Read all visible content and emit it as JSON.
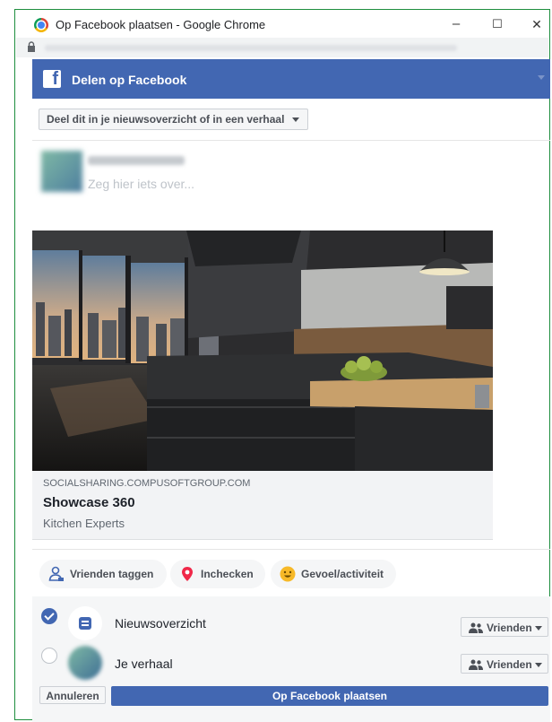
{
  "window": {
    "title": "Op Facebook plaatsen - Google Chrome",
    "minimize_glyph": "–",
    "maximize_glyph": "☐",
    "close_glyph": "✕"
  },
  "dialog": {
    "header_title": "Delen op Facebook",
    "brand_color": "#4267b2",
    "audience_select": "Deel dit in je nieuwsoverzicht of in een verhaal",
    "composer_placeholder": "Zeg hier iets over..."
  },
  "link_card": {
    "domain": "SOCIALSHARING.COMPUSOFTGROUP.COM",
    "title": "Showcase 360",
    "description": "Kitchen Experts"
  },
  "actions": [
    {
      "label": "Vrienden taggen",
      "icon": "tag-friends-icon"
    },
    {
      "label": "Inchecken",
      "icon": "location-pin-icon"
    },
    {
      "label": "Gevoel/activiteit",
      "icon": "smiley-icon"
    }
  ],
  "destinations": [
    {
      "label": "Nieuwsoverzicht",
      "checked": true,
      "privacy": "Vrienden"
    },
    {
      "label": "Je verhaal",
      "checked": false,
      "privacy": "Vrienden"
    }
  ],
  "footer": {
    "cancel_label": "Annuleren",
    "post_label": "Op Facebook plaatsen"
  }
}
